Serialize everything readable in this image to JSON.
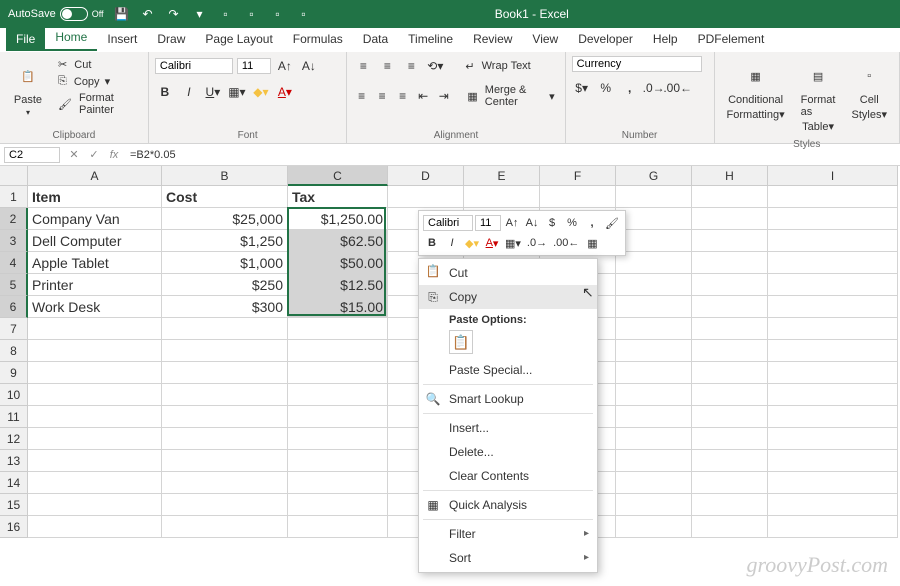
{
  "titlebar": {
    "autosave": "AutoSave",
    "autosave_state": "Off",
    "title": "Book1 - Excel"
  },
  "menu": {
    "file": "File",
    "home": "Home",
    "insert": "Insert",
    "draw": "Draw",
    "page_layout": "Page Layout",
    "formulas": "Formulas",
    "data": "Data",
    "timeline": "Timeline",
    "review": "Review",
    "view": "View",
    "developer": "Developer",
    "help": "Help",
    "pdfelement": "PDFelement"
  },
  "ribbon": {
    "clipboard": {
      "label": "Clipboard",
      "paste": "Paste",
      "cut": "Cut",
      "copy": "Copy",
      "format_painter": "Format Painter"
    },
    "font": {
      "label": "Font",
      "name": "Calibri",
      "size": "11"
    },
    "alignment": {
      "label": "Alignment",
      "wrap": "Wrap Text",
      "merge": "Merge & Center"
    },
    "number": {
      "label": "Number",
      "format": "Currency"
    },
    "styles": {
      "label": "Styles",
      "conditional": "Conditional",
      "formatting": "Formatting",
      "format_as": "Format as",
      "table": "Table",
      "cell": "Cell",
      "styles_word": "Styles"
    }
  },
  "formula_bar": {
    "name": "C2",
    "formula": "=B2*0.05"
  },
  "columns": [
    "A",
    "B",
    "C",
    "D",
    "E",
    "F",
    "G",
    "H",
    "I"
  ],
  "col_widths": {
    "A": 134,
    "B": 126,
    "C": 100,
    "D": 76,
    "E": 76,
    "F": 76,
    "G": 76,
    "H": 76,
    "I": 130
  },
  "rows": [
    1,
    2,
    3,
    4,
    5,
    6,
    7,
    8,
    9,
    10,
    11,
    12,
    13,
    14,
    15,
    16
  ],
  "headers": {
    "A": "Item",
    "B": "Cost",
    "C": "Tax"
  },
  "data": [
    {
      "item": "Company Van",
      "cost": "$25,000",
      "tax": "$1,250.00"
    },
    {
      "item": "Dell Computer",
      "cost": "$1,250",
      "tax": "$62.50"
    },
    {
      "item": "Apple Tablet",
      "cost": "$1,000",
      "tax": "$50.00"
    },
    {
      "item": "Printer",
      "cost": "$250",
      "tax": "$12.50"
    },
    {
      "item": "Work Desk",
      "cost": "$300",
      "tax": "$15.00"
    }
  ],
  "mini_toolbar": {
    "font": "Calibri",
    "size": "11"
  },
  "context_menu": {
    "cut": "Cut",
    "copy": "Copy",
    "paste_options": "Paste Options:",
    "paste_special": "Paste Special...",
    "smart_lookup": "Smart Lookup",
    "insert": "Insert...",
    "delete": "Delete...",
    "clear": "Clear Contents",
    "quick_analysis": "Quick Analysis",
    "filter": "Filter",
    "sort": "Sort"
  },
  "watermark": "groovyPost.com"
}
